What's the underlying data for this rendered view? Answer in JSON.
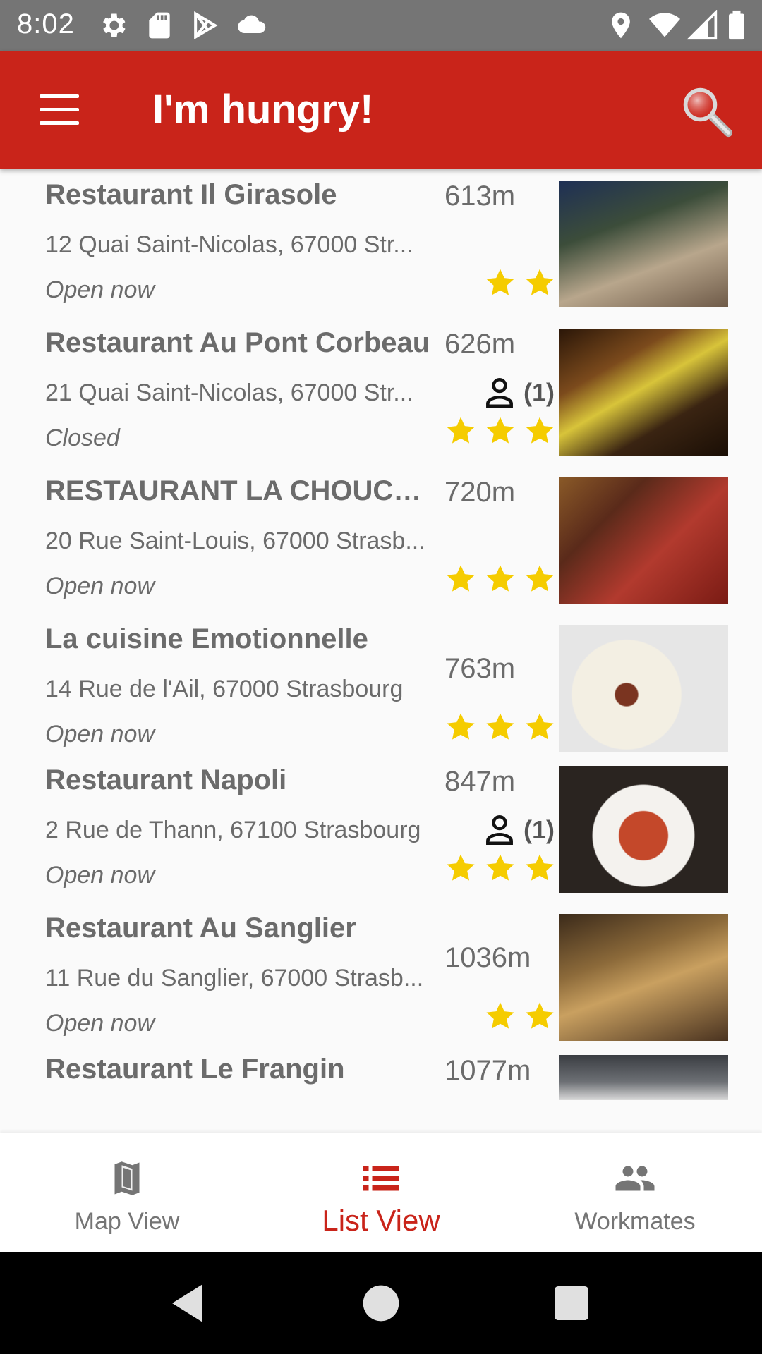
{
  "status_bar": {
    "time": "8:02",
    "icons": [
      "gear-icon",
      "sd-card-icon",
      "play-store-icon",
      "cloud-icon",
      "location-icon",
      "wifi-icon",
      "signal-icon",
      "battery-icon"
    ]
  },
  "app_bar": {
    "title": "I'm hungry!",
    "menu_icon": "hamburger-menu-icon",
    "search_icon": "search-icon",
    "background": "#c9241a"
  },
  "restaurants": [
    {
      "name": "Restaurant Il Girasole",
      "address": "12 Quai Saint-Nicolas, 67000 Str...",
      "hours": "Open now",
      "distance": "613m",
      "workmates": "",
      "rating": 2
    },
    {
      "name": "Restaurant Au Pont Corbeau",
      "address": "21 Quai Saint-Nicolas, 67000 Str...",
      "hours": "Closed",
      "distance": "626m",
      "workmates": "(1)",
      "rating": 3
    },
    {
      "name": "RESTAURANT LA CHOUCR...",
      "address": "20 Rue Saint-Louis, 67000 Strasb...",
      "hours": "Open now",
      "distance": "720m",
      "workmates": "",
      "rating": 3
    },
    {
      "name": "La cuisine Emotionnelle",
      "address": "14 Rue de l'Ail, 67000 Strasbourg",
      "hours": "Open now",
      "distance": "763m",
      "workmates": "",
      "rating": 3
    },
    {
      "name": "Restaurant Napoli",
      "address": "2 Rue de Thann, 67100 Strasbourg",
      "hours": "Open now",
      "distance": "847m",
      "workmates": "(1)",
      "rating": 3
    },
    {
      "name": "Restaurant Au Sanglier",
      "address": "11 Rue du Sanglier, 67000 Strasb...",
      "hours": "Open now",
      "distance": "1036m",
      "workmates": "",
      "rating": 2
    },
    {
      "name": "Restaurant Le Frangin",
      "address": "",
      "hours": "",
      "distance": "1077m",
      "workmates": "",
      "rating": 0
    }
  ],
  "bottom_nav": {
    "items": [
      {
        "label": "Map View",
        "icon": "map-icon",
        "active": false
      },
      {
        "label": "List View",
        "icon": "list-icon",
        "active": true
      },
      {
        "label": "Workmates",
        "icon": "people-icon",
        "active": false
      }
    ],
    "active_color": "#c9241a",
    "inactive_color": "#757575"
  },
  "system_nav": {
    "buttons": [
      "back-icon",
      "home-icon",
      "recents-icon"
    ]
  },
  "colors": {
    "star": "#f5cc00",
    "text": "#6b6b6b"
  }
}
